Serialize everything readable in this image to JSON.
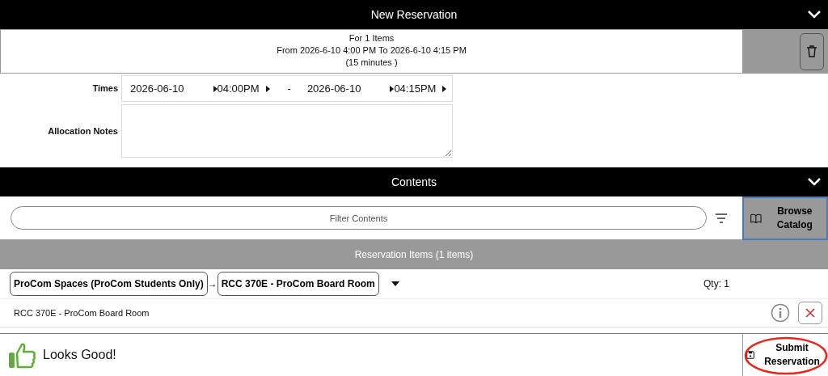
{
  "header": {
    "title": "New Reservation",
    "expanded": true
  },
  "summary": {
    "lines": [
      "For 1 Items",
      "From 2026-6-10 4:00 PM To 2026-6-10 4:15 PM",
      "(15 minutes )"
    ]
  },
  "times": {
    "label": "Times",
    "start_date": "2026-06-10",
    "start_time": "04:00PM",
    "separator": "-",
    "end_date": "2026-06-10",
    "end_time": "04:15PM"
  },
  "notes": {
    "label": "Allocation Notes"
  },
  "contents": {
    "title": "Contents",
    "expanded": true,
    "filter_placeholder": "Filter Contents",
    "browse_button": "Browse Catalog"
  },
  "reservation_items": {
    "title": "Reservation Items (1 items)",
    "path": [
      "ProCom Spaces (ProCom Students Only)",
      "RCC 370E - ProCom Board Room"
    ],
    "arrow": "→",
    "qty": "Qty: 1",
    "items": [
      {
        "name": "RCC 370E - ProCom Board Room"
      }
    ]
  },
  "footer": {
    "status": "Looks Good!",
    "submit_button": "Submit Reservation",
    "submit_highlighted": true
  }
}
